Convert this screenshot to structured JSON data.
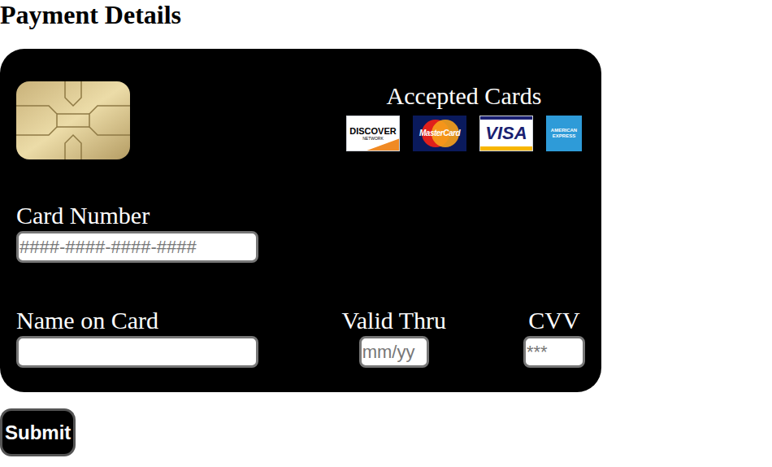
{
  "heading": "Payment Details",
  "accepted_cards": {
    "label": "Accepted Cards",
    "logos": [
      {
        "kind": "discover",
        "lines": [
          "DISCOVER",
          "NETWORK"
        ]
      },
      {
        "kind": "mastercard",
        "lines": [
          "MasterCard"
        ]
      },
      {
        "kind": "visa",
        "lines": [
          "VISA"
        ]
      },
      {
        "kind": "amex",
        "lines": [
          "AMERICAN",
          "EXPRESS"
        ]
      }
    ]
  },
  "card_number": {
    "label": "Card Number",
    "placeholder": "####-####-####-####",
    "value": ""
  },
  "name_on_card": {
    "label": "Name on Card",
    "placeholder": "",
    "value": ""
  },
  "valid_thru": {
    "label": "Valid Thru",
    "placeholder": "mm/yy",
    "value": ""
  },
  "cvv": {
    "label": "CVV",
    "placeholder": "***",
    "value": ""
  },
  "submit": {
    "label": "Submit"
  }
}
